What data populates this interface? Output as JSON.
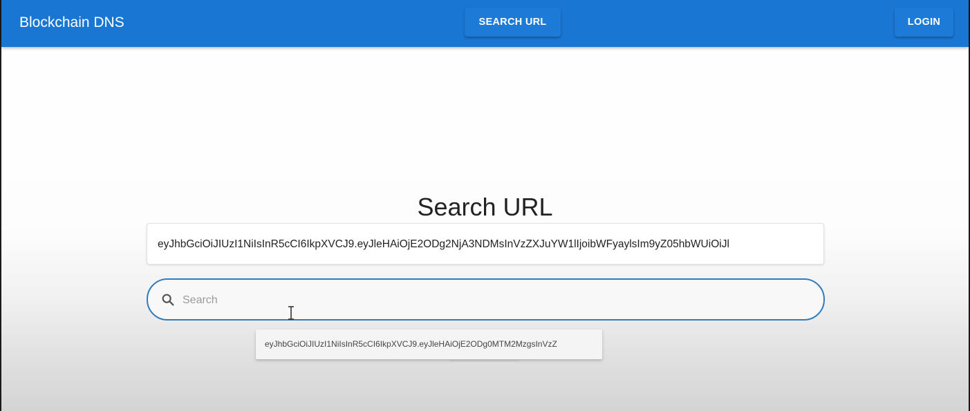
{
  "colors": {
    "appbar": "#1976d2",
    "accent_border": "#2e7bc0",
    "title_text": "#222222"
  },
  "header": {
    "brand": "Blockchain DNS",
    "search_url_label": "SEARCH URL",
    "login_label": "LOGIN"
  },
  "main": {
    "title": "Search URL",
    "token_value": "eyJhbGciOiJIUzI1NiIsInR5cCI6IkpXVCJ9.eyJleHAiOjE2ODg2NjA3NDMsInVzZXJuYW1lIjoibWFyaylsIm9yZ05hbWUiOiJl",
    "search": {
      "icon": "search-icon",
      "placeholder": "Search",
      "value": ""
    },
    "suggestions": [
      "eyJhbGciOiJIUzI1NiIsInR5cCI6IkpXVCJ9.eyJleHAiOjE2ODg0MTM2MzgsInVzZ"
    ]
  }
}
